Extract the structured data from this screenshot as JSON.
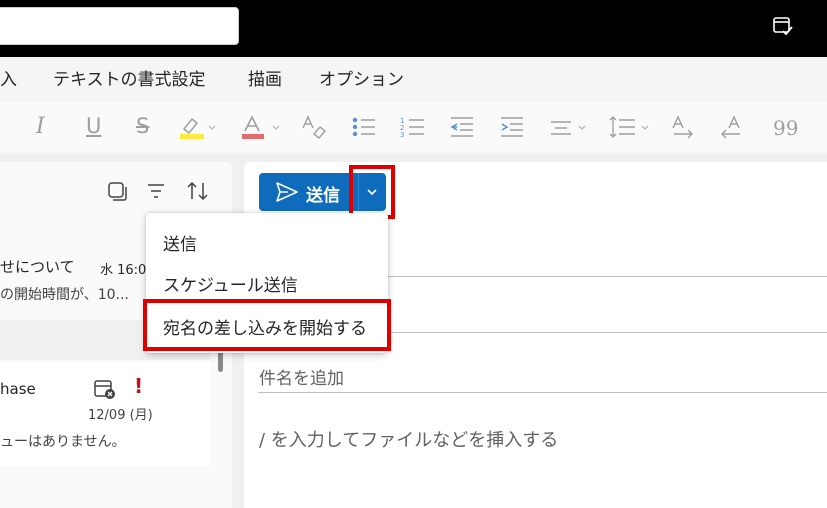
{
  "topbar": {
    "search_placeholder": "",
    "icon": "calendar-check-icon"
  },
  "ribbon": {
    "tabs": [
      {
        "label": "入"
      },
      {
        "label": "テキストの書式設定"
      },
      {
        "label": "描画"
      },
      {
        "label": "オプション"
      }
    ],
    "italic_glyph": "I",
    "underline_glyph": "U",
    "strike_glyph": "S",
    "quote_glyph": "99",
    "highlight_color": "#ffeb3b",
    "font_color": "#e06c6c"
  },
  "mail_list": {
    "messages": [
      {
        "subject": "せについて",
        "time": "水 16:0",
        "preview": "の開始時間が、10..."
      },
      {
        "sender": "hase",
        "date": "12/09 (月)",
        "preview": "ューはありません。",
        "flag": "!"
      }
    ]
  },
  "compose": {
    "send_label": "送信",
    "subject_placeholder": "件名を追加",
    "body_placeholder": "/ を入力してファイルなどを挿入する"
  },
  "send_menu": {
    "items": [
      {
        "label": "送信"
      },
      {
        "label": "スケジュール送信"
      },
      {
        "label": "宛名の差し込みを開始する"
      }
    ]
  },
  "colors": {
    "accent": "#0f6cbd",
    "highlight_box": "#e00000",
    "flag": "#c50f1f"
  }
}
